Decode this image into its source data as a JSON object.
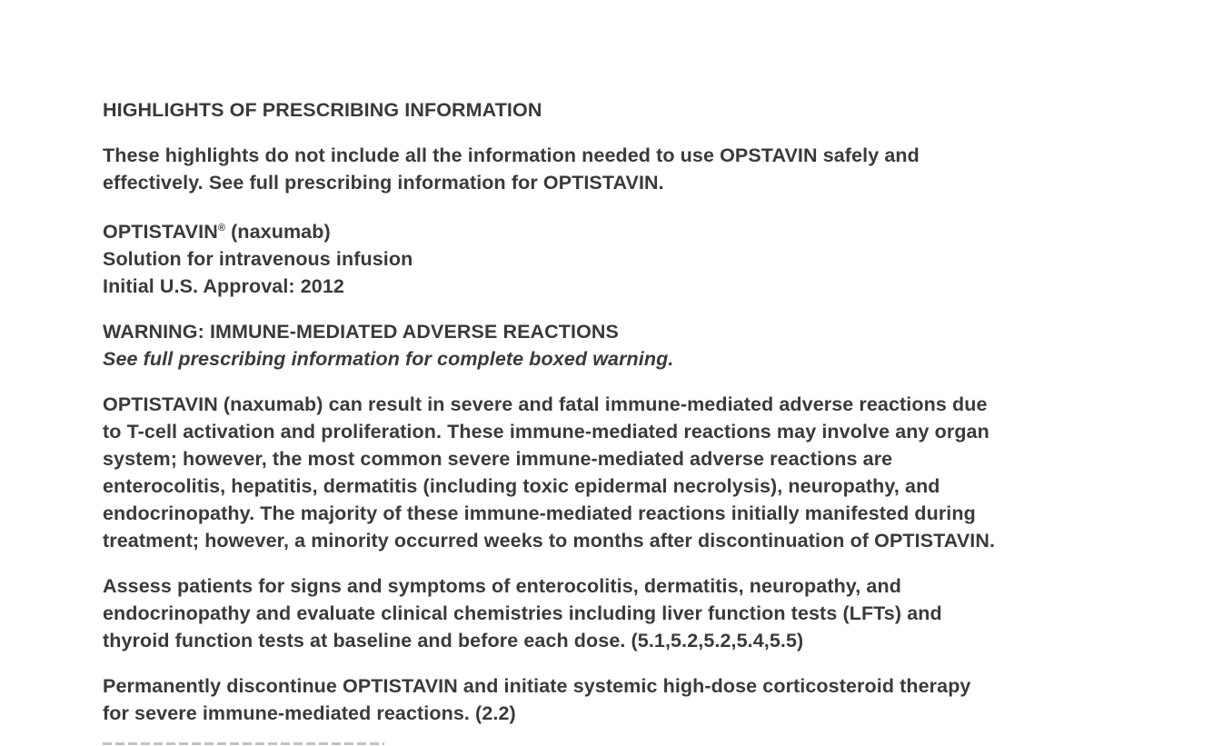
{
  "document": {
    "title": "HIGHLIGHTS OF PRESCRIBING INFORMATION",
    "intro": [
      "These highlights do not include all the information needed to use OPSTAVIN safely and",
      "effectively. See full prescribing information for OPTISTAVIN."
    ],
    "product": {
      "name": "OPTISTAVIN",
      "registered_mark": "®",
      "generic": " (naxumab)",
      "form": "Solution for intravenous infusion",
      "approval": "Initial U.S. Approval: 2012"
    },
    "warning": {
      "heading": "WARNING: IMMUNE-MEDIATED ADVERSE REACTIONS",
      "subheading": "See full prescribing information for complete boxed warning.",
      "paragraphs": [
        [
          "OPTISTAVIN (naxumab) can result in severe and fatal immune-mediated adverse reactions due",
          "to T-cell activation and proliferation. These immune-mediated reactions may involve any organ",
          "system; however, the most common severe immune-mediated adverse reactions are",
          "enterocolitis, hepatitis, dermatitis (including toxic epidermal necrolysis), neuropathy, and",
          "endocrinopathy. The majority of these immune-mediated reactions initially manifested during",
          "treatment; however, a minority occurred weeks to months after discontinuation of OPTISTAVIN."
        ],
        [
          "Assess patients for signs and symptoms of enterocolitis, dermatitis, neuropathy, and",
          "endocrinopathy and evaluate clinical chemistries including liver function tests (LFTs) and",
          "thyroid function tests at baseline and before each dose. (5.1,5.2,5.2,5.4,5.5)"
        ],
        [
          "Permanently discontinue OPTISTAVIN and initiate systemic high-dose corticosteroid therapy",
          "for severe immune-mediated reactions. (2.2)"
        ]
      ]
    }
  }
}
